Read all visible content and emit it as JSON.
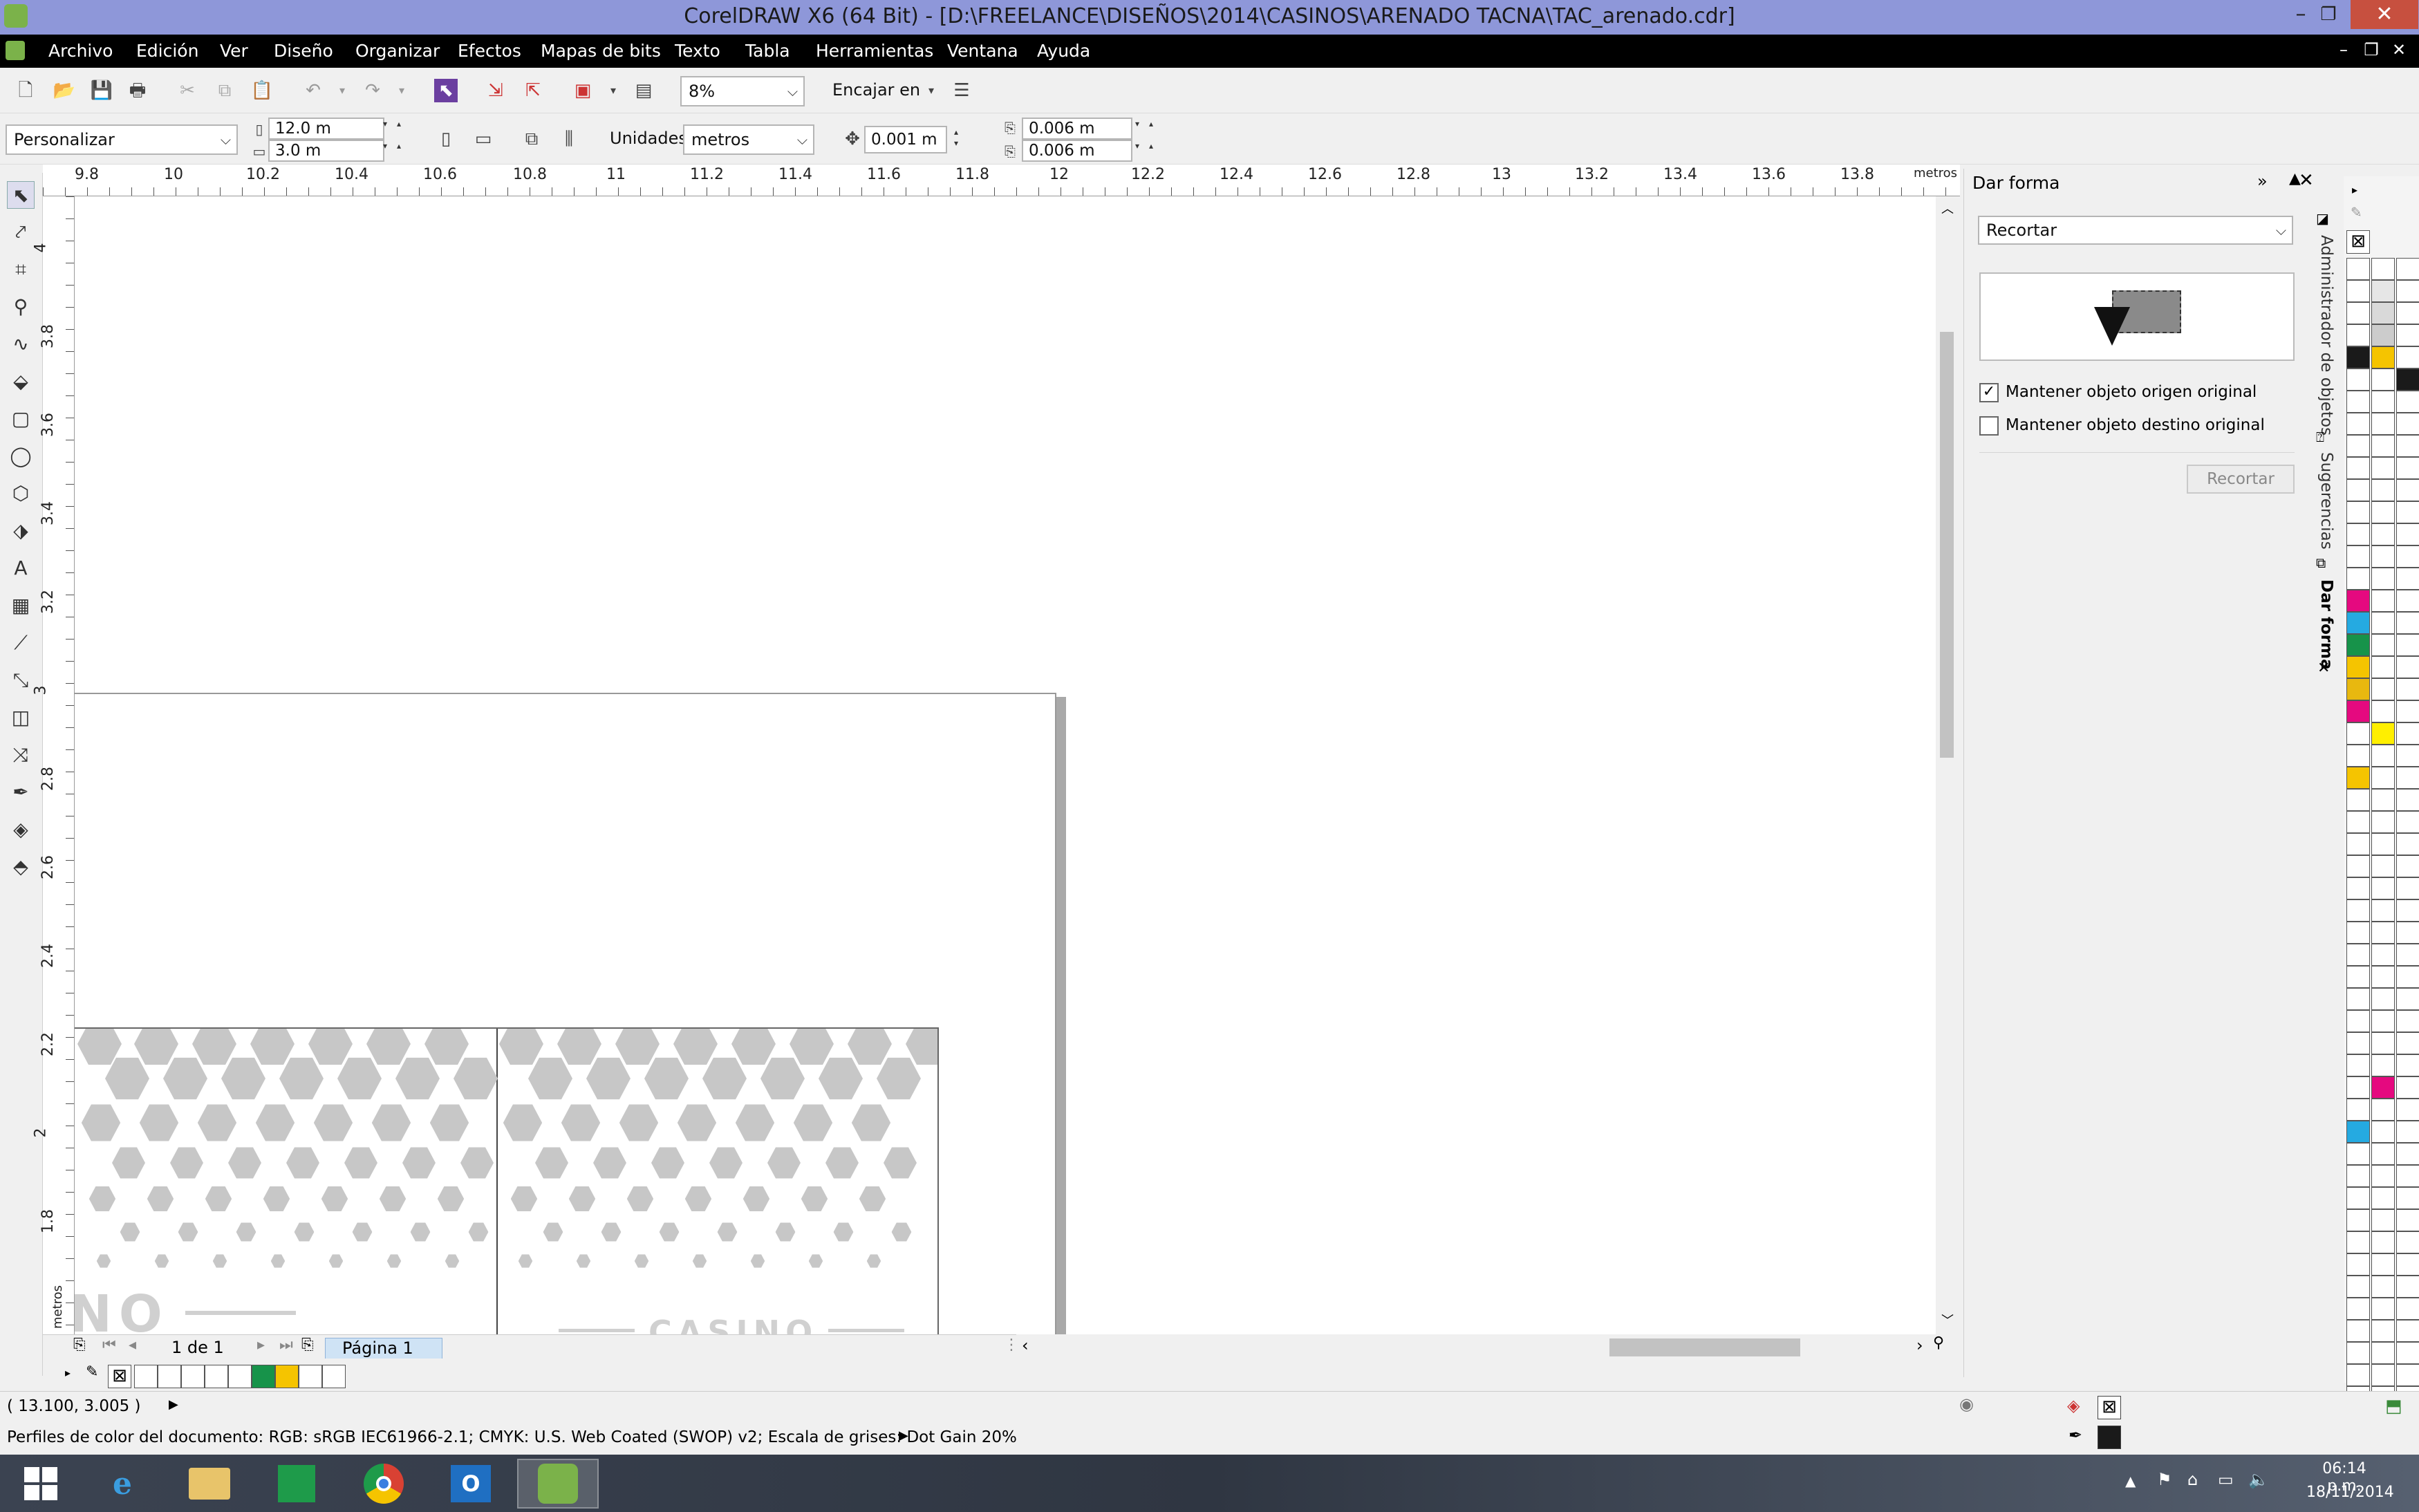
{
  "window": {
    "title": "CorelDRAW X6 (64 Bit) - [D:\\FREELANCE\\DISEÑOS\\2014\\CASINOS\\ARENADO TACNA\\TAC_arenado.cdr]",
    "min_glyph": "–",
    "max_glyph": "❐",
    "close_glyph": "✕"
  },
  "menu": {
    "items": [
      "Archivo",
      "Edición",
      "Ver",
      "Diseño",
      "Organizar",
      "Efectos",
      "Mapas de bits",
      "Texto",
      "Tabla",
      "Herramientas",
      "Ventana",
      "Ayuda"
    ]
  },
  "toolbar": {
    "zoom": "8%",
    "snap_label": "Encajar en"
  },
  "property_bar": {
    "page_preset": "Personalizar",
    "page_width": "12.0 m",
    "page_height": "3.0 m",
    "units_label": "Unidades:",
    "units_value": "metros",
    "nudge": "0.001 m",
    "dup_x": "0.006 m",
    "dup_y": "0.006 m"
  },
  "ruler": {
    "h_labels": [
      "9.8",
      "10",
      "10.2",
      "10.4",
      "10.6",
      "10.8",
      "11",
      "11.2",
      "11.4",
      "11.6",
      "11.8",
      "12",
      "12.2",
      "12.4",
      "12.6",
      "12.8",
      "13",
      "13.2",
      "13.4",
      "13.6",
      "13.8"
    ],
    "h_unit": "metros",
    "v_labels": [
      "4",
      "3.8",
      "3.6",
      "3.4",
      "3.2",
      "3",
      "2.8",
      "2.6",
      "2.4",
      "2.2",
      "2",
      "1.8"
    ],
    "v_unit": "metros"
  },
  "canvas": {
    "artwork_text_left": "NO",
    "artwork_text_right": "CASINO"
  },
  "pagenav": {
    "counter": "1 de 1",
    "page_tab": "Página 1"
  },
  "docker": {
    "title": "Dar forma",
    "mode": "Recortar",
    "keep_source_label": "Mantener objeto origen original",
    "keep_source_checked": true,
    "keep_target_label": "Mantener objeto destino original",
    "keep_target_checked": false,
    "apply_button": "Recortar",
    "tabs": [
      "Administrador de objetos",
      "Sugerencias",
      "Dar forma"
    ]
  },
  "palette": {
    "colors": [
      "#ffffff",
      "#e6e6e6",
      "#d9d9d9",
      "#cccccc",
      "#1a1a1a",
      "#f5c400",
      "#ffffff",
      "#e5097f",
      "#25aae1",
      "#17934a",
      "#f5c400",
      "#e8b80f",
      "#e5097f",
      "#ffef00",
      "#f5c400",
      "#e5097f",
      "#25aae1",
      "#e5097f"
    ],
    "doc_colors": [
      "#ffffff",
      "#ffffff",
      "#ffffff",
      "#ffffff",
      "#ffffff",
      "#17934a",
      "#f5c400",
      "#ffffff",
      "#ffffff"
    ]
  },
  "status": {
    "coords": "( 13.100, 3.005 )",
    "color_profile": "Perfiles de color del documento: RGB: sRGB IEC61966-2.1; CMYK: U.S. Web Coated (SWOP) v2; Escala de grises: Dot Gain 20%",
    "fill_color": "none",
    "outline_color": "#1a1a1a"
  },
  "taskbar": {
    "time": "06:14 p.m.",
    "date": "18/11/2014",
    "apps": [
      "start",
      "internet-explorer",
      "file-explorer",
      "store",
      "chrome",
      "outlook",
      "coreldraw"
    ]
  }
}
